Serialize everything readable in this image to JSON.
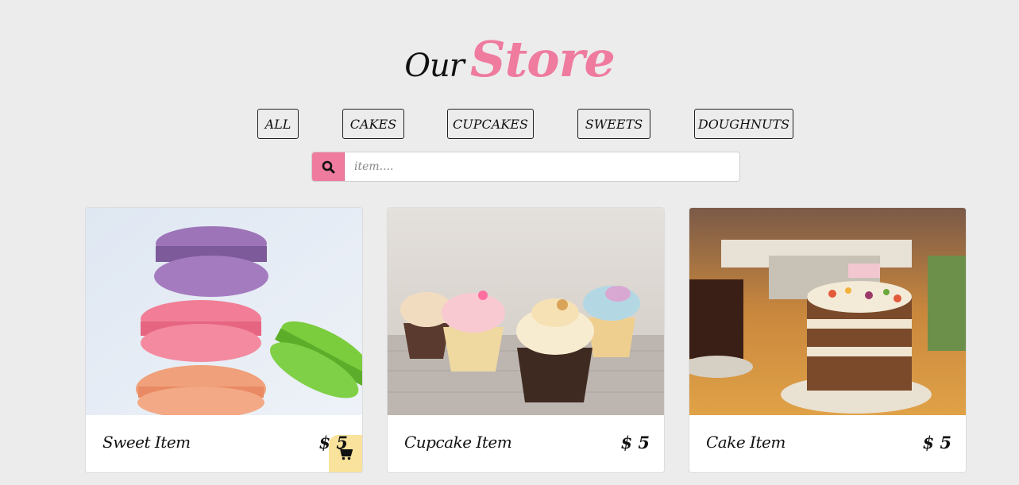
{
  "header": {
    "title_prefix": "Our",
    "title_main": "Store"
  },
  "filters": [
    {
      "label": "ALL"
    },
    {
      "label": "CAKES"
    },
    {
      "label": "CUPCAKES"
    },
    {
      "label": "SWEETS"
    },
    {
      "label": "DOUGHNUTS"
    }
  ],
  "search": {
    "placeholder": "item....",
    "icon": "search-icon"
  },
  "products": [
    {
      "name": "Sweet Item",
      "price": "$ 5",
      "image": "macarons-photo"
    },
    {
      "name": "Cupcake Item",
      "price": "$ 5",
      "image": "cupcakes-photo"
    },
    {
      "name": "Cake Item",
      "price": "$ 5",
      "image": "cake-photo"
    }
  ],
  "colors": {
    "background": "#ececec",
    "accent_pink": "#ef7b9f",
    "cart_yellow": "#f9e29b"
  }
}
